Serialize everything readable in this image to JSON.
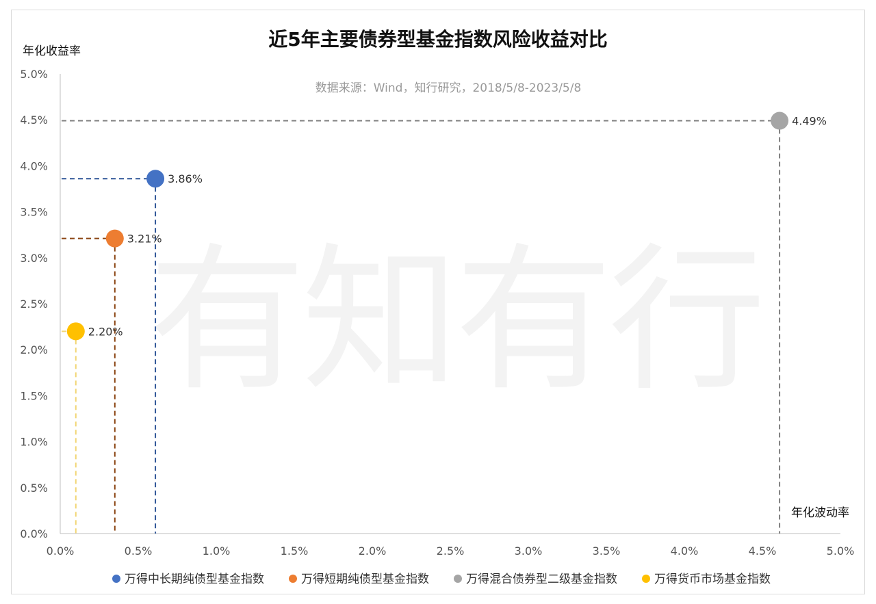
{
  "title": "近5年主要债券型基金指数风险收益对比",
  "subtitle": "数据来源：Wind，知行研究，2018/5/8-2023/5/8",
  "watermark": "有知有行",
  "chart_data": {
    "type": "scatter",
    "xlabel": "年化波动率",
    "ylabel": "年化收益率",
    "xlim": [
      0,
      5
    ],
    "ylim": [
      0,
      5
    ],
    "x_ticks": [
      "0.0%",
      "0.5%",
      "1.0%",
      "1.5%",
      "2.0%",
      "2.5%",
      "3.0%",
      "3.5%",
      "4.0%",
      "4.5%",
      "5.0%"
    ],
    "y_ticks": [
      "0.0%",
      "0.5%",
      "1.0%",
      "1.5%",
      "2.0%",
      "2.5%",
      "3.0%",
      "3.5%",
      "4.0%",
      "4.5%",
      "5.0%"
    ],
    "grid": false,
    "legend_position": "bottom",
    "series": [
      {
        "name": "万得中长期纯债型基金指数",
        "x": 0.61,
        "y": 3.86,
        "label": "3.86%",
        "color": "#4472C4",
        "guide_color": "#2F5597"
      },
      {
        "name": "万得短期纯债型基金指数",
        "x": 0.35,
        "y": 3.21,
        "label": "3.21%",
        "color": "#ED7D31",
        "guide_color": "#8B4513"
      },
      {
        "name": "万得混合债券型二级基金指数",
        "x": 4.61,
        "y": 4.49,
        "label": "4.49%",
        "color": "#A5A5A5",
        "guide_color": "#7F7F7F"
      },
      {
        "name": "万得货币市场基金指数",
        "x": 0.1,
        "y": 2.2,
        "label": "2.20%",
        "color": "#FFC000",
        "guide_color": "#F2D675"
      }
    ]
  }
}
